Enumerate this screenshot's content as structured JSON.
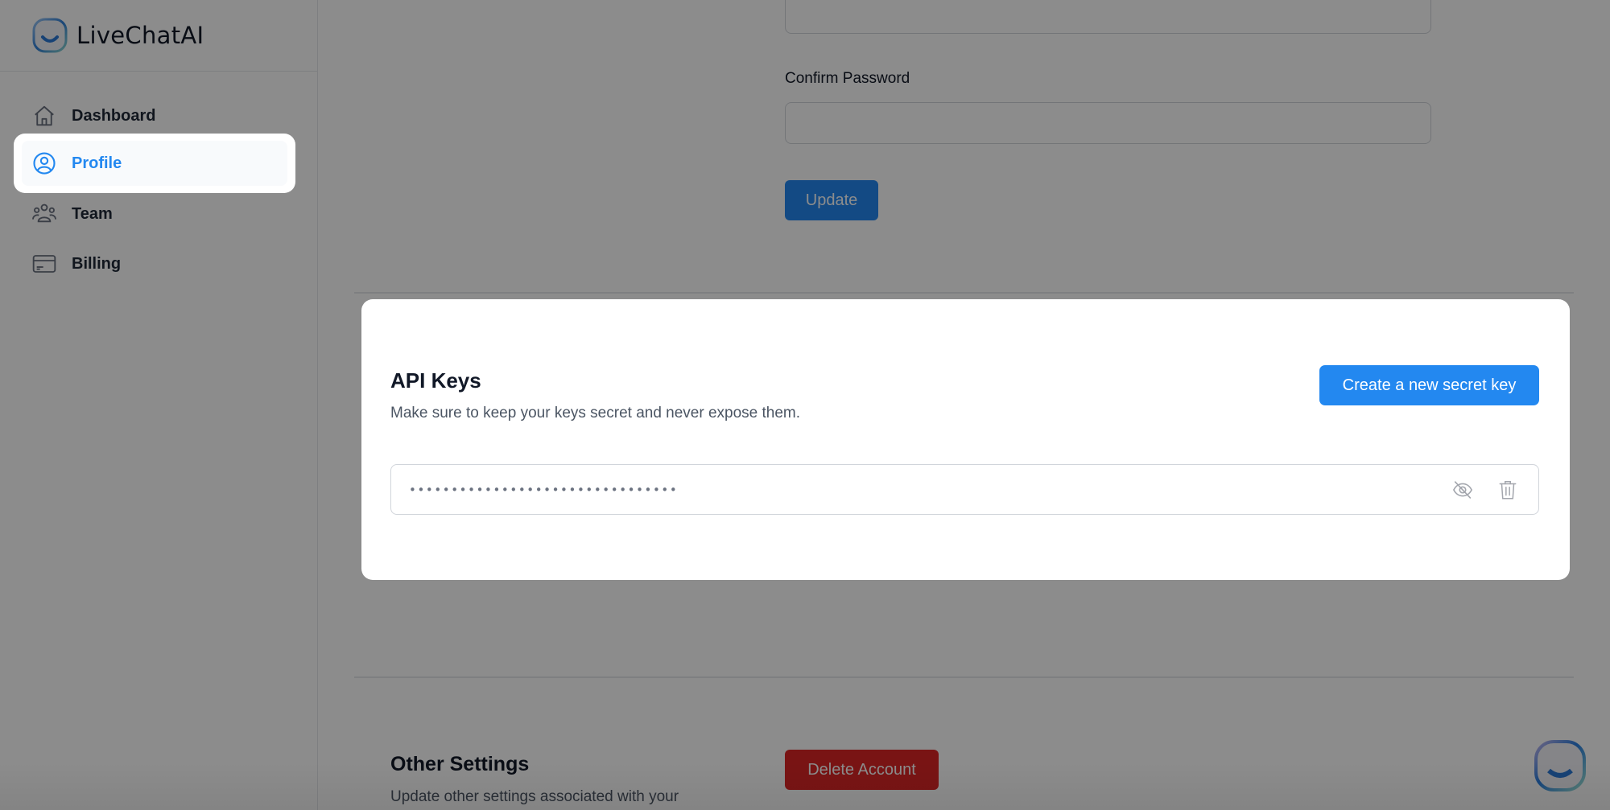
{
  "app": {
    "brand_name": "LiveChatAI",
    "logo_icon": "smiley-bubble-icon"
  },
  "sidebar": {
    "items": [
      {
        "label": "Dashboard",
        "icon": "home-icon",
        "active": false
      },
      {
        "label": "Profile",
        "icon": "user-circle-icon",
        "active": true
      },
      {
        "label": "Team",
        "icon": "users-group-icon",
        "active": false
      },
      {
        "label": "Billing",
        "icon": "credit-card-icon",
        "active": false
      }
    ]
  },
  "password_section": {
    "new_password_value": "",
    "confirm_label": "Confirm Password",
    "confirm_value": "",
    "update_label": "Update"
  },
  "api_keys": {
    "title": "API Keys",
    "description": "Make sure to keep your keys secret and never expose them.",
    "create_label": "Create a new secret key",
    "keys": [
      {
        "masked_value": "••••••••••••••••••••••••••••••••",
        "visibility_icon": "eye-off-icon",
        "delete_icon": "trash-icon"
      }
    ]
  },
  "other_settings": {
    "title": "Other Settings",
    "description": "Update other settings associated with your",
    "delete_label": "Delete Account"
  },
  "chat_widget": {
    "icon": "chat-launcher-icon"
  },
  "colors": {
    "accent": "#2388f0",
    "danger": "#dc2626",
    "scrim": "rgba(0,0,0,0.45)"
  }
}
